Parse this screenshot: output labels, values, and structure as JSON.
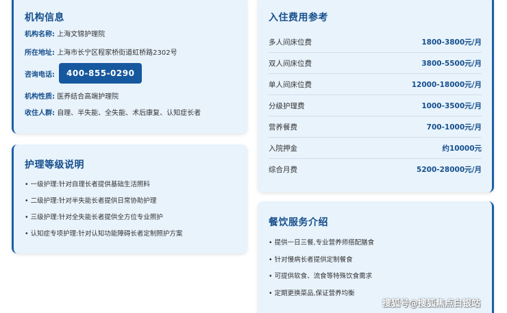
{
  "info": {
    "title": "机构信息",
    "name_label": "机构名称:",
    "name_value": "上海文锦护理院",
    "address_label": "所在地址:",
    "address_value": "上海市长宁区程家桥街道虹桥路2302号",
    "phone_label": "咨询电话:",
    "phone_value": "400-855-0290",
    "nature_label": "机构性质:",
    "nature_value": "医养结合高端护理院",
    "target_label": "收住人群:",
    "target_value": "自理、半失能、全失能、术后康复、认知症长者"
  },
  "care": {
    "title": "护理等级说明",
    "items": [
      "• 一级护理:针对自理长者提供基础生活照料",
      "• 二级护理:针对半失能长者提供日常协助护理",
      "• 三级护理:针对全失能长者提供全方位专业照护",
      "• 认知症专项护理:针对认知功能障碍长者定制照护方案"
    ]
  },
  "fees": {
    "title": "入住费用参考",
    "rows": [
      {
        "name": "多人间床位费",
        "value": "1800-3800元/月"
      },
      {
        "name": "双人间床位费",
        "value": "3800-5500元/月"
      },
      {
        "name": "单人间床位费",
        "value": "12000-18000元/月"
      },
      {
        "name": "分级护理费",
        "value": "1000-3500元/月"
      },
      {
        "name": "营养餐费",
        "value": "700-1000元/月"
      },
      {
        "name": "入院押金",
        "value": "约10000元"
      },
      {
        "name": "综合月费",
        "value": "5200-28000元/月"
      }
    ]
  },
  "dining": {
    "title": "餐饮服务介绍",
    "items": [
      "• 提供一日三餐,专业营养师搭配膳食",
      "• 针对慢病长者提供定制餐食",
      "• 可提供软食、流食等特殊饮食需求",
      "• 定期更换菜品,保证营养均衡"
    ]
  },
  "watermark": "搜狐号@搜狐焦点白银站",
  "colors": {
    "accent": "#164f8c",
    "card_bg": "#e8f3fc",
    "button": "#16589f"
  }
}
